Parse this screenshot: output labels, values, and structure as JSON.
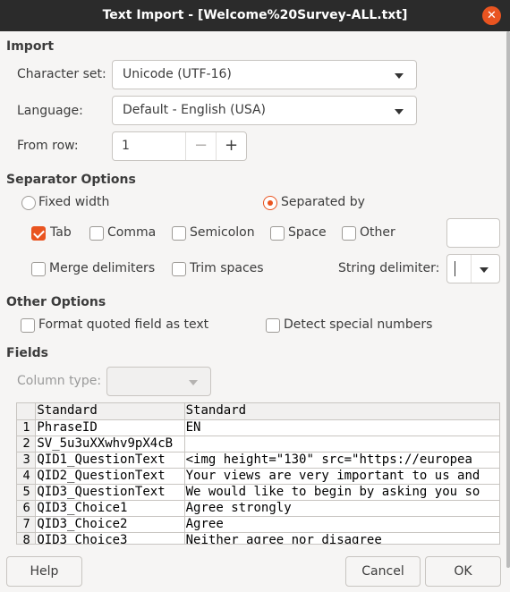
{
  "window": {
    "title": "Text Import - [Welcome%20Survey-ALL.txt]",
    "close_icon": "close-icon"
  },
  "import": {
    "section": "Import",
    "charset_label": "Character set:",
    "charset_value": "Unicode (UTF-16)",
    "language_label": "Language:",
    "language_value": "Default - English (USA)",
    "from_row_label": "From row:",
    "from_row_value": "1",
    "minus": "−",
    "plus": "+"
  },
  "separator": {
    "section": "Separator Options",
    "fixed_width": "Fixed width",
    "separated_by": "Separated by",
    "mode": "separated_by",
    "tab": "Tab",
    "comma": "Comma",
    "semicolon": "Semicolon",
    "space": "Space",
    "other": "Other",
    "other_value": "",
    "merge": "Merge delimiters",
    "trim": "Trim spaces",
    "string_delim_label": "String delimiter:",
    "string_delim_value": "",
    "checked": {
      "tab": true,
      "comma": false,
      "semicolon": false,
      "space": false,
      "other": false,
      "merge": false,
      "trim": false
    }
  },
  "other_options": {
    "section": "Other Options",
    "format_quoted": "Format quoted field as text",
    "detect_special": "Detect special numbers",
    "checked": {
      "format_quoted": false,
      "detect_special": false
    }
  },
  "fields": {
    "section": "Fields",
    "column_type_label": "Column type:",
    "column_type_value": "",
    "headers": [
      "Standard",
      "Standard"
    ],
    "rows": [
      {
        "n": "1",
        "c1": "PhraseID",
        "c2": "EN"
      },
      {
        "n": "2",
        "c1": "SV_5u3uXXwhv9pX4cB",
        "c2": ""
      },
      {
        "n": "3",
        "c1": "QID1_QuestionText",
        "c2": "<img height=\"130\" src=\"https://europea"
      },
      {
        "n": "4",
        "c1": "QID2_QuestionText",
        "c2": "Your views are very important to us and"
      },
      {
        "n": "5",
        "c1": "QID3_QuestionText",
        "c2": "We would like to begin by asking you so"
      },
      {
        "n": "6",
        "c1": "QID3_Choice1",
        "c2": "Agree strongly"
      },
      {
        "n": "7",
        "c1": "QID3_Choice2",
        "c2": "Agree"
      },
      {
        "n": "8",
        "c1": "QID3_Choice3",
        "c2": "Neither agree nor disagree"
      }
    ]
  },
  "buttons": {
    "help": "Help",
    "cancel": "Cancel",
    "ok": "OK"
  },
  "colors": {
    "accent": "#e95420",
    "titlebar": "#2b2b2b"
  }
}
